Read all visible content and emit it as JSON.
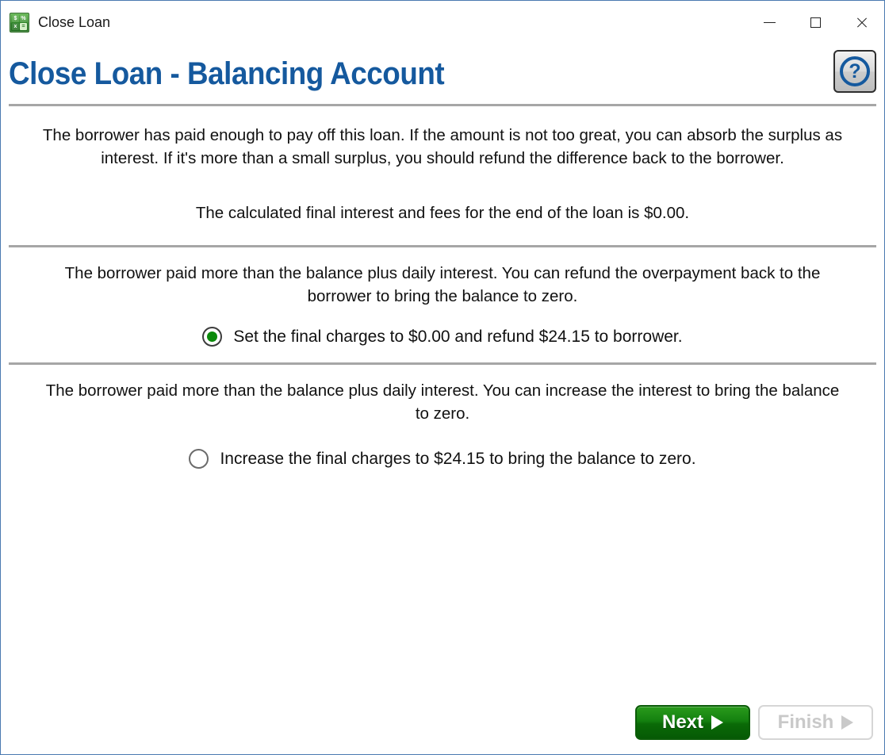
{
  "window": {
    "title": "Close Loan",
    "app_icon": "calculator-icon",
    "icon_glyphs": [
      "$",
      "%",
      "x",
      "="
    ],
    "controls": {
      "minimize": "minimize-icon",
      "maximize": "maximize-icon",
      "close": "close-icon"
    },
    "border_color": "#4a7ab0"
  },
  "header": {
    "page_title": "Close Loan - Balancing Account",
    "title_color": "#15599e",
    "help_label": "?",
    "help_icon": "question-mark-icon"
  },
  "sections": {
    "intro": {
      "paragraph_1": "The borrower has paid enough to pay off this loan. If the amount is not too great, you can absorb the surplus as interest. If it's more than a small surplus, you should refund the difference back to the borrower.",
      "paragraph_2": "The calculated final interest and fees for the end of the loan is $0.00."
    },
    "refund": {
      "paragraph": "The borrower paid more than the balance plus daily interest. You can refund the overpayment back to the borrower to bring the balance to zero.",
      "option_label": "Set the final charges to $0.00 and refund $24.15 to borrower.",
      "selected": true
    },
    "increase": {
      "paragraph": "The borrower paid more than the balance plus daily interest. You can increase the interest to bring the balance to zero.",
      "option_label": "Increase the final charges to $24.15 to bring the balance to zero.",
      "selected": false
    }
  },
  "footer": {
    "next_label": "Next",
    "next_color": "#0f7a0c",
    "finish_label": "Finish",
    "finish_enabled": false,
    "arrow_icon": "play-triangle-icon"
  }
}
